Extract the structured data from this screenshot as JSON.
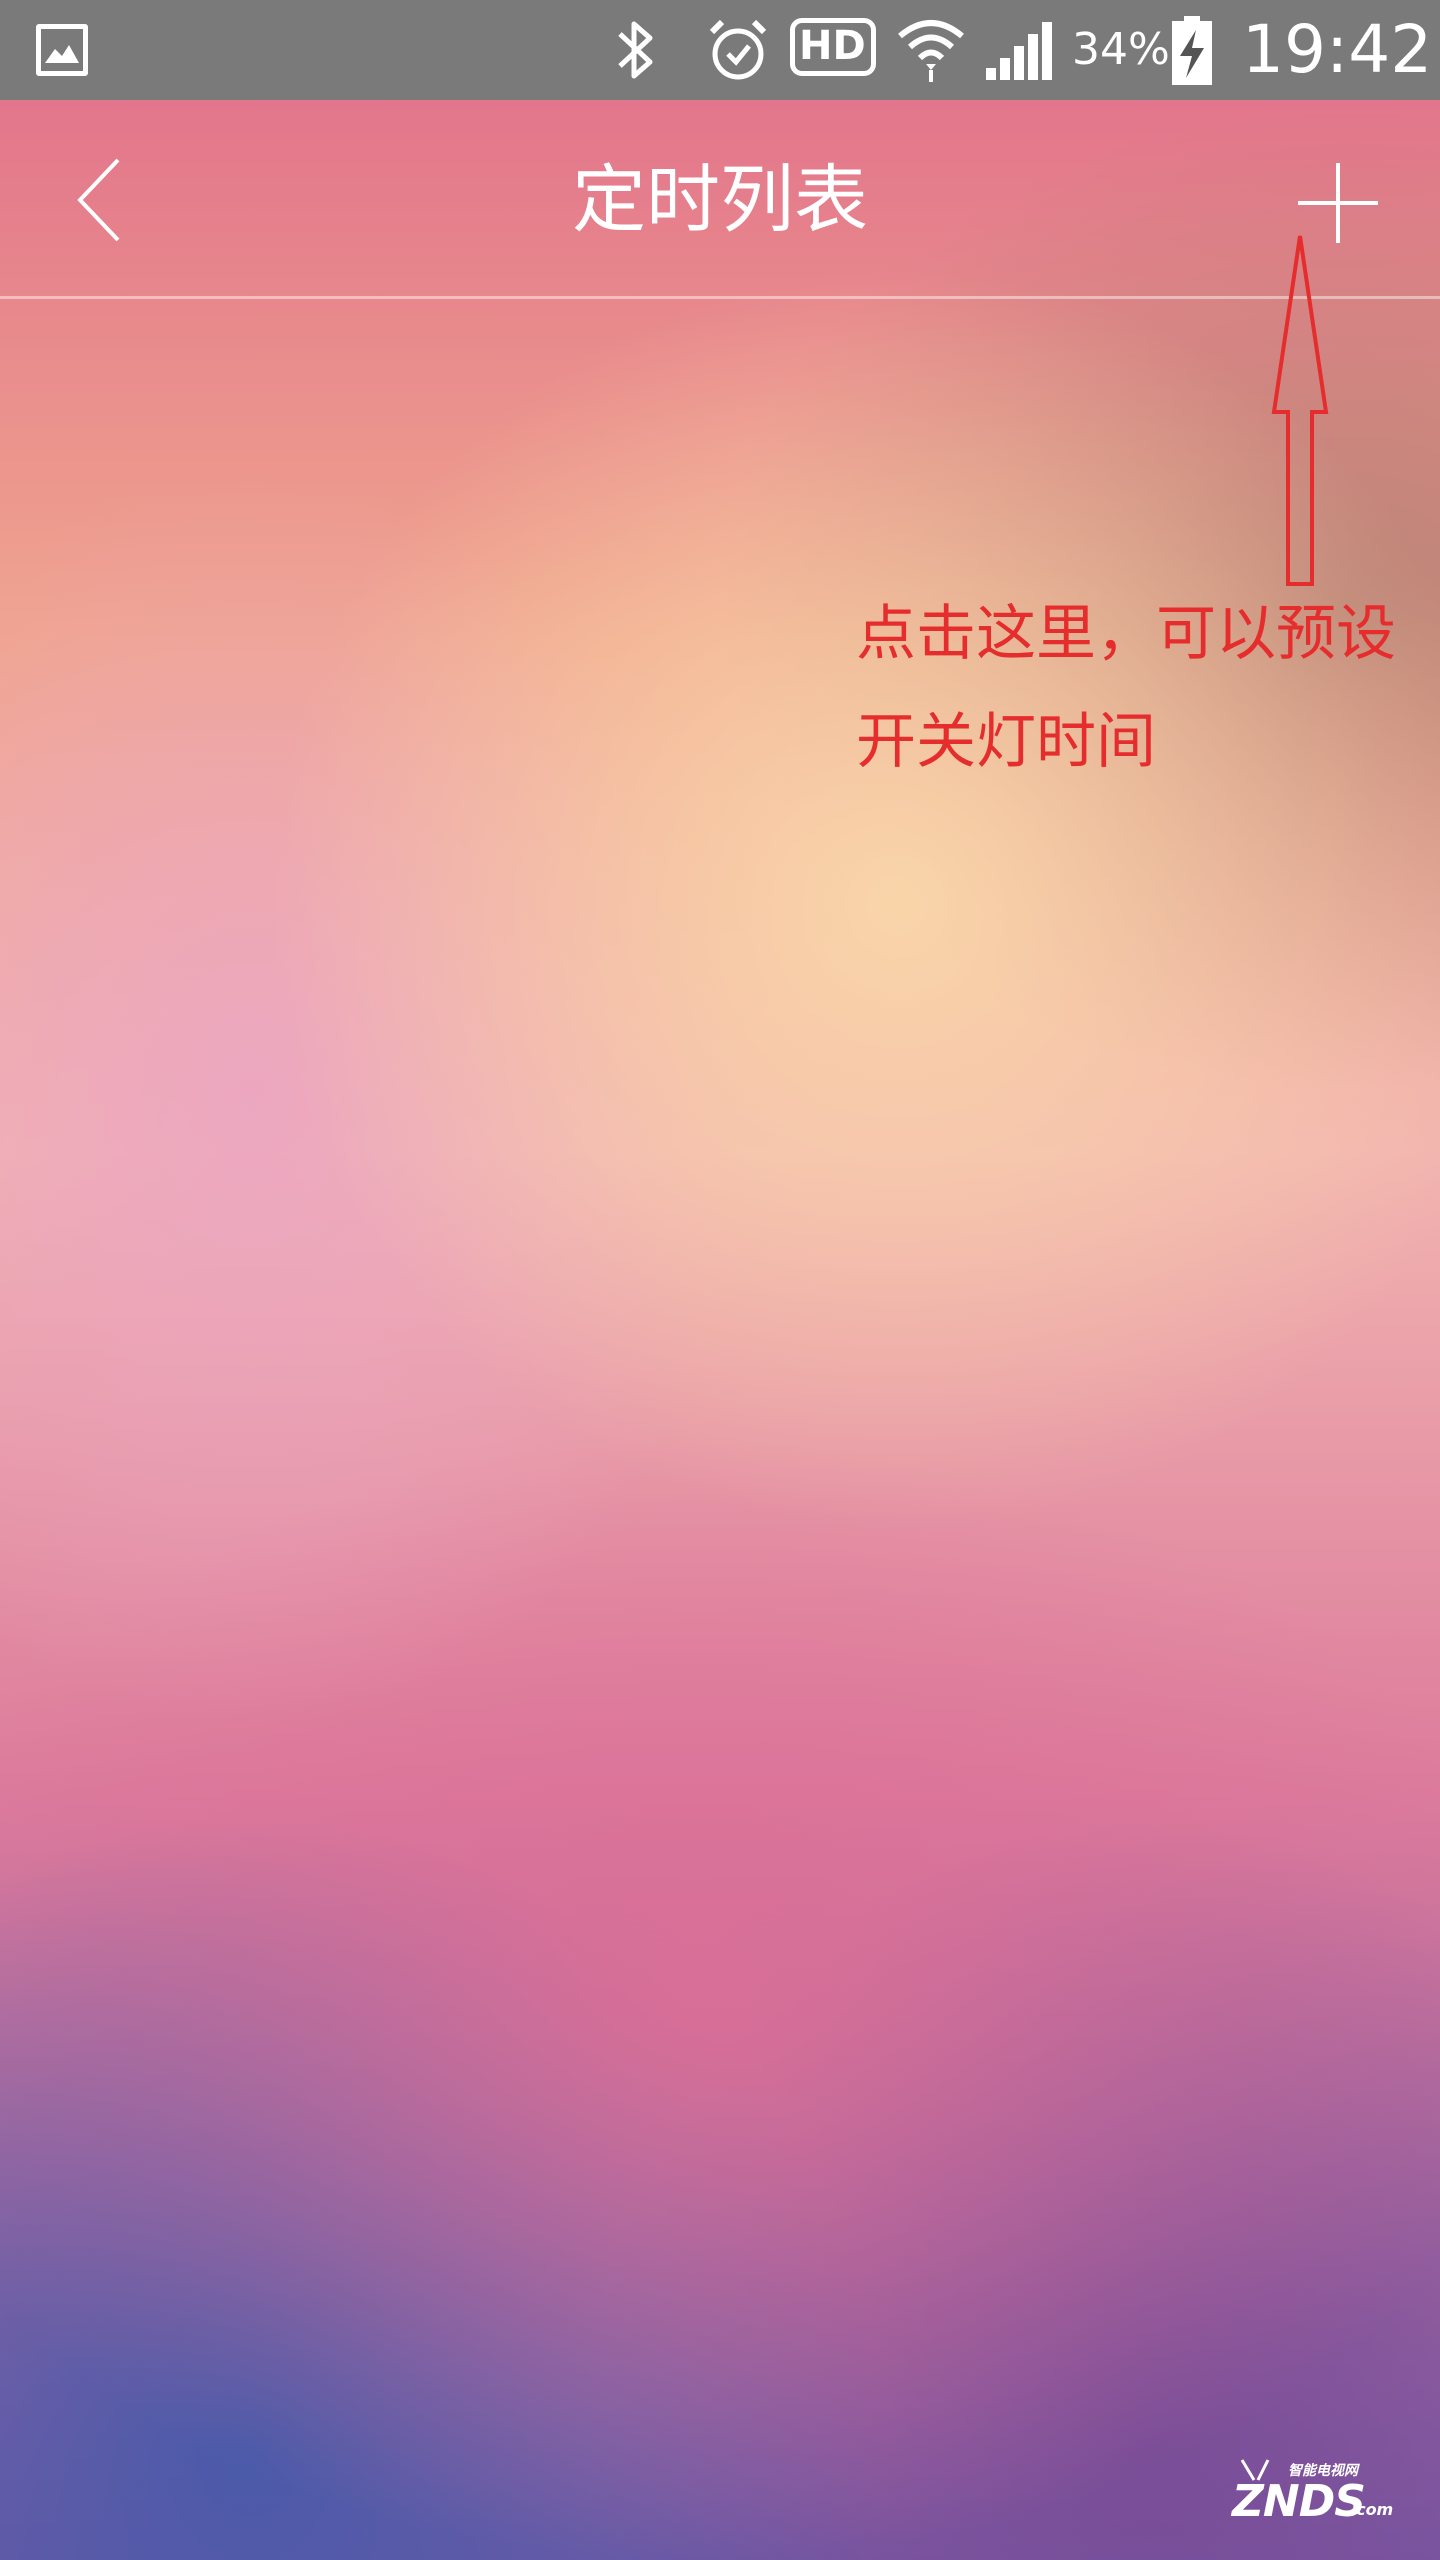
{
  "status_bar": {
    "battery_percent": "34%",
    "time": "19:42",
    "icons": [
      "gallery-icon",
      "bluetooth-icon",
      "alarm-icon",
      "hd-icon",
      "wifi-icon",
      "signal-icon",
      "battery-charging-icon"
    ],
    "hd_label": "HD"
  },
  "header": {
    "title": "定时列表",
    "back_icon": "chevron-left-icon",
    "add_icon": "plus-icon"
  },
  "annotation": {
    "line1": "点击这里，可以预设",
    "line2": "开关灯时间",
    "color": "#e52d2d"
  },
  "watermark": {
    "subtitle": "智能电视网",
    "brand": "ZNDS",
    "suffix": ".com"
  }
}
